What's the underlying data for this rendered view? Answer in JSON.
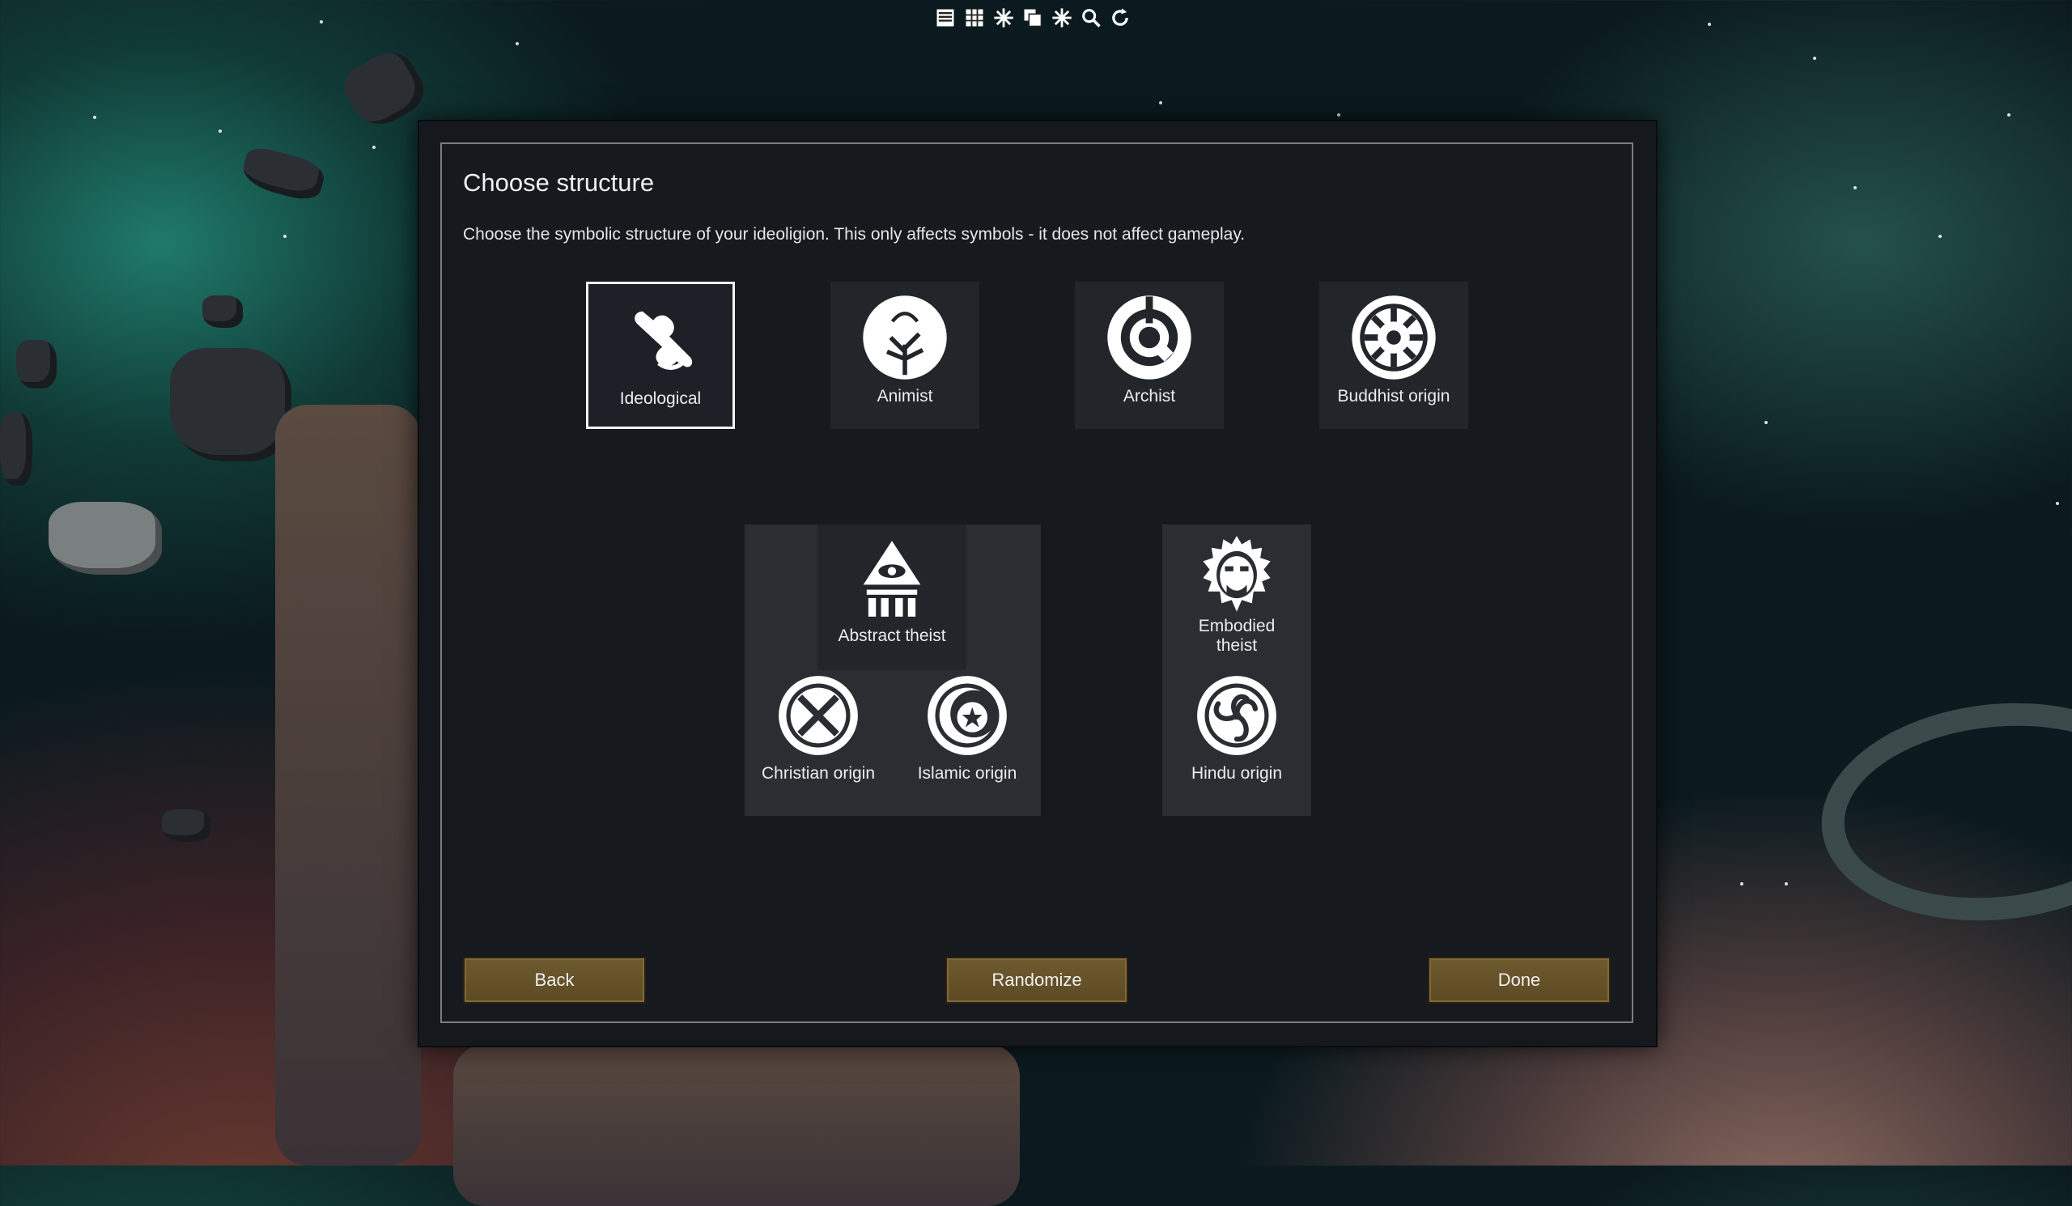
{
  "toolbar": {
    "icons": [
      "list-icon",
      "grid-icon",
      "sparkle-icon",
      "copy-icon",
      "sparkle-alt-icon",
      "search-icon",
      "refresh-icon"
    ]
  },
  "dialog": {
    "title": "Choose structure",
    "description": "Choose the symbolic structure of your ideoligion. This only affects symbols - it does not affect gameplay.",
    "structures": {
      "ideological": "Ideological",
      "animist": "Animist",
      "archist": "Archist",
      "buddhist": "Buddhist origin",
      "abstract_theist": "Abstract theist",
      "christian": "Christian origin",
      "islamic": "Islamic origin",
      "embodied_theist_line1": "Embodied",
      "embodied_theist_line2": "theist",
      "hindu": "Hindu origin"
    },
    "selected": "Ideological",
    "buttons": {
      "back": "Back",
      "randomize": "Randomize",
      "done": "Done"
    }
  },
  "colors": {
    "button": "#6a562b",
    "panel": "#16191d",
    "selected_border": "#f2f2f2"
  }
}
